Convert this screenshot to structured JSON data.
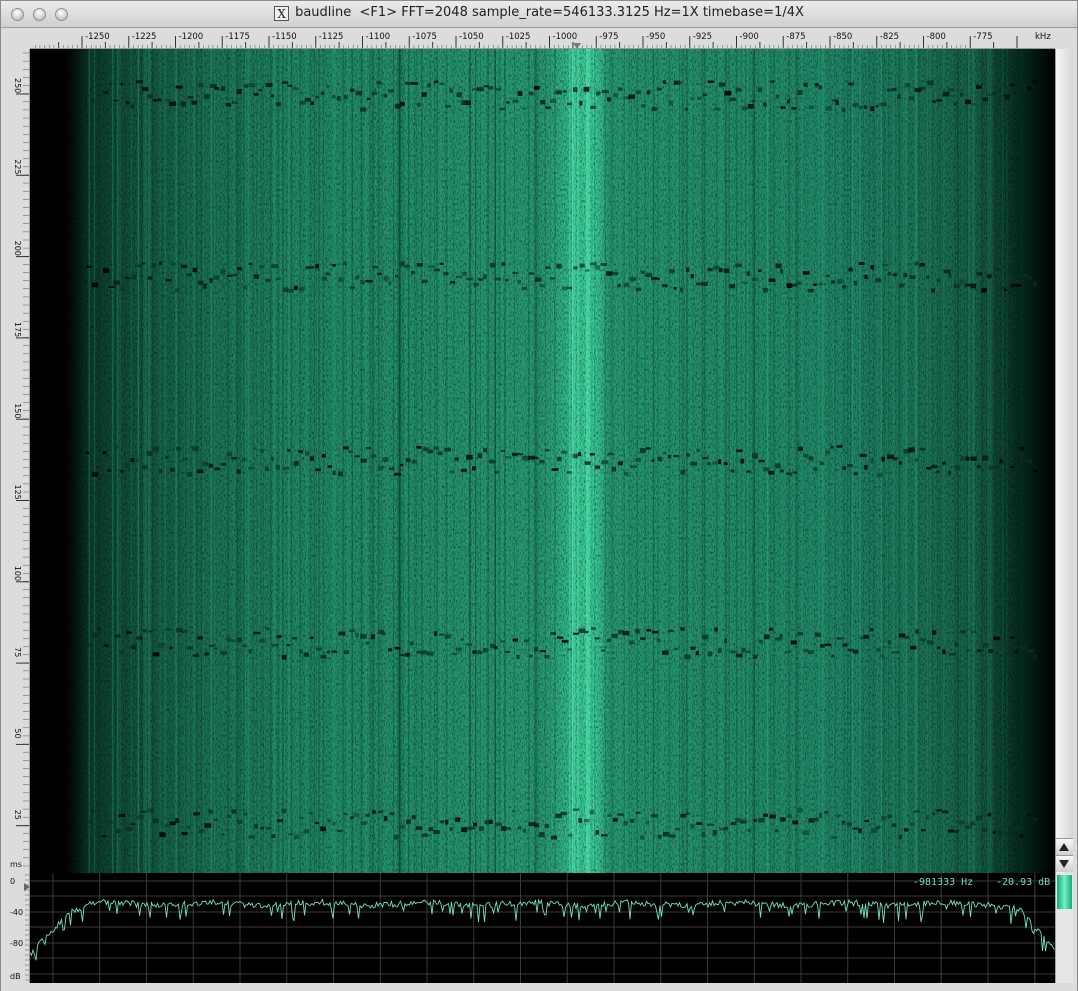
{
  "window": {
    "app_name": "baudline",
    "title_info": "<F1> FFT=2048 sample_rate=546133.3125 Hz=1X timebase=1/4X"
  },
  "frequency_axis": {
    "unit": "kHz",
    "ticks": [
      "-1250",
      "-1225",
      "-1200",
      "-1175",
      "-1150",
      "-1125",
      "-1100",
      "-1075",
      "-1050",
      "-1025",
      "-1000",
      "-975",
      "-950",
      "-925",
      "-900",
      "-875",
      "-850",
      "-825",
      "-800",
      "-775"
    ]
  },
  "time_axis": {
    "unit": "ms",
    "ticks": [
      "250",
      "225",
      "200",
      "175",
      "150",
      "125",
      "100",
      "75",
      "50",
      "25"
    ]
  },
  "spectrum_axis": {
    "unit": "dB",
    "ticks": [
      "0",
      "-40",
      "-80"
    ]
  },
  "readout": {
    "frequency": "-981333 Hz",
    "level": "-20.93 dB"
  },
  "colors": {
    "window_bg": "#dcdcdc",
    "display_bg": "#000000",
    "signal_dark": "#0b3d2e",
    "signal_mid": "#1f8f6b",
    "signal_bright": "#3fd6a0",
    "trace": "#74e0bf",
    "grid": "#3a3a3a",
    "readout_text": "#79d8b9"
  },
  "icons": {
    "window_controls": [
      "close-circle-icon",
      "minimize-circle-icon",
      "zoom-circle-icon"
    ],
    "app_icon": "x11-icon",
    "scroll_up": "arrow-up-icon",
    "scroll_down": "arrow-down-icon",
    "marker": "triangle-marker-icon"
  }
}
